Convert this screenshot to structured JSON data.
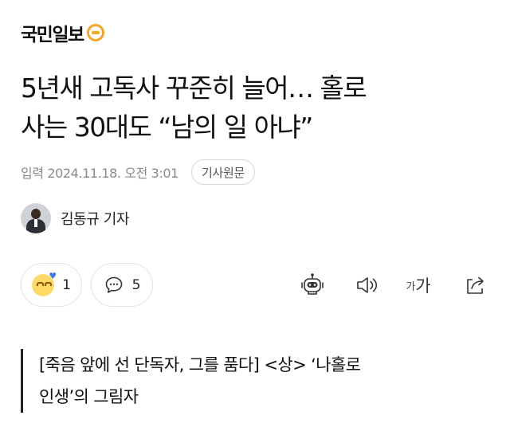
{
  "brand": {
    "name": "국민일보"
  },
  "article": {
    "headline_line1": "5년새 고독사 꾸준히 늘어… 홀로",
    "headline_line2": "사는 30대도 “남의 일 아냐”",
    "date": "입력 2024.11.18. 오전 3:01",
    "original_button": "기사원문",
    "reporter": "김동규 기자"
  },
  "reactions": {
    "likes": "1",
    "comments": "5"
  },
  "tools": {
    "font_small": "가",
    "font_big": "가"
  },
  "quote": {
    "line1": "[죽음 앞에 선 단독자, 그를 품다] <상> ‘나홀로",
    "line2": "인생’의 그림자"
  },
  "colors": {
    "accent": "#f5a623",
    "reaction_heart": "#3b7cf5"
  }
}
